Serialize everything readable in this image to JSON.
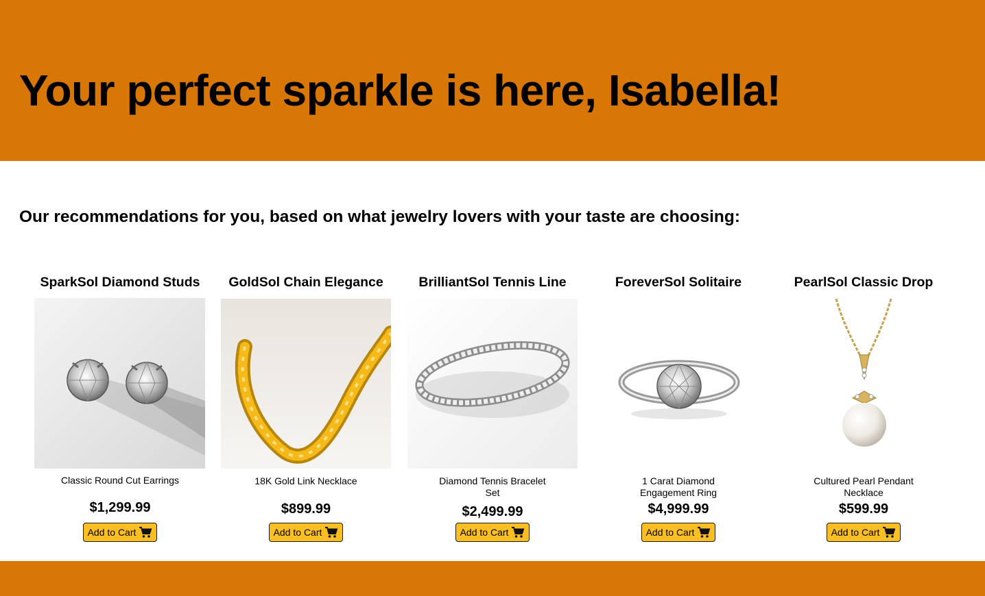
{
  "header": {
    "headline": "Your perfect sparkle is here, Isabella!"
  },
  "main": {
    "subheading": "Our recommendations for you, based on what jewelry lovers with your taste are choosing:"
  },
  "products": [
    {
      "name": "SparkSol Diamond Studs",
      "description": "Classic Round Cut Earrings",
      "price": "$1,299.99",
      "image_icon": "diamond-stud-earrings-image",
      "button_label": "Add to Cart"
    },
    {
      "name": "GoldSol Chain Elegance",
      "description": "18K Gold Link Necklace",
      "price": "$899.99",
      "image_icon": "gold-chain-necklace-image",
      "button_label": "Add to Cart"
    },
    {
      "name": "BrilliantSol Tennis Line",
      "description": "Diamond Tennis Bracelet Set",
      "price": "$2,499.99",
      "image_icon": "tennis-bracelet-image",
      "button_label": "Add to Cart"
    },
    {
      "name": "ForeverSol Solitaire",
      "description": "1 Carat Diamond Engagement Ring",
      "price": "$4,999.99",
      "image_icon": "solitaire-ring-image",
      "button_label": "Add to Cart"
    },
    {
      "name": "PearlSol Classic Drop",
      "description": "Cultured Pearl Pendant Necklace",
      "price": "$599.99",
      "image_icon": "pearl-pendant-image",
      "button_label": "Add to Cart"
    }
  ],
  "colors": {
    "banner": "#d97706",
    "button": "#fbbf24"
  }
}
